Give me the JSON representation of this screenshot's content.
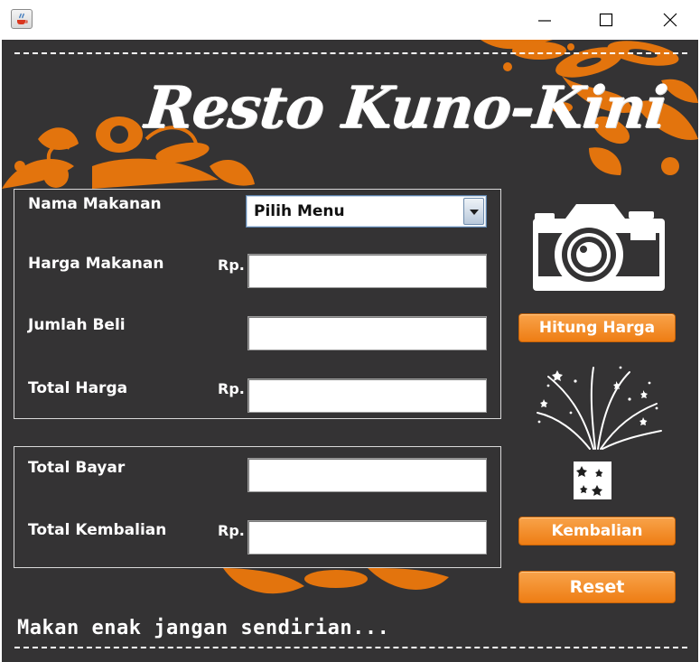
{
  "window": {
    "app_icon": "java-cup-icon",
    "controls": [
      "minimize-icon",
      "maximize-icon",
      "close-icon"
    ]
  },
  "brand": {
    "title": "Resto Kuno-Kini"
  },
  "order": {
    "nama_label": "Nama Makanan",
    "menu_selected": "Pilih Menu",
    "harga_label": "Harga Makanan",
    "harga_currency": "Rp.",
    "harga_value": "",
    "jumlah_label": "Jumlah Beli",
    "jumlah_value": "",
    "total_label": "Total Harga",
    "total_currency": "Rp.",
    "total_value": ""
  },
  "payment": {
    "bayar_label": "Total Bayar",
    "bayar_value": "",
    "kembalian_label": "Total Kembalian",
    "kembalian_currency": "Rp.",
    "kembalian_value": ""
  },
  "buttons": {
    "hitung_label": "Hitung Harga",
    "kembalian_label": "Kembalian",
    "reset_label": "Reset"
  },
  "footer": {
    "tagline": "Makan enak jangan sendirian..."
  },
  "colors": {
    "background": "#343334",
    "accent_orange": "#ee7d14",
    "text": "#ffffff"
  },
  "icons": [
    "camera-icon",
    "fireworks-icon",
    "dice-icon",
    "floral-ornament"
  ]
}
